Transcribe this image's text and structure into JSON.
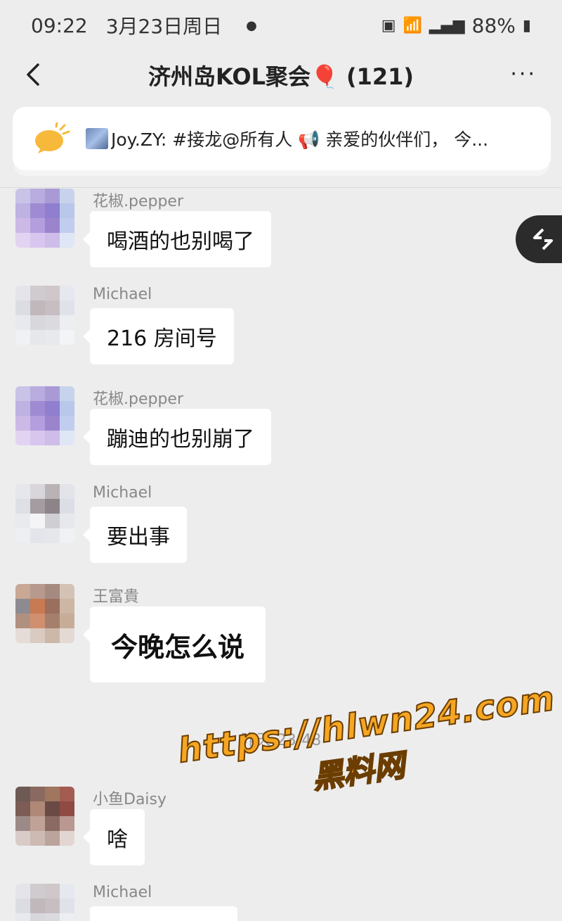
{
  "status_bar": {
    "time": "09:22",
    "date": "3月23日周日",
    "battery": "88%"
  },
  "nav": {
    "title": "济州岛KOL聚会🎈 (121)",
    "more": "···"
  },
  "announcement": {
    "text": "Joy.ZY: #接龙@所有人 📢 亲爱的伙伴们， 今..."
  },
  "messages": [
    {
      "sender": "花椒.pepper",
      "text": "喝酒的也别喝了"
    },
    {
      "sender": "Michael",
      "text": "216  房间号"
    },
    {
      "sender": "花椒.pepper",
      "text": "蹦迪的也别崩了"
    },
    {
      "sender": "Michael",
      "text": "要出事"
    },
    {
      "sender": "王富貴",
      "text": "今晚怎么说"
    },
    {
      "sender": "小鱼Daisy",
      "text": "啥"
    },
    {
      "sender": "Michael",
      "text": ""
    }
  ],
  "timestamp": "昨天 23:48",
  "watermark": {
    "url": "https://hlwn24.com",
    "name": "黑料网"
  },
  "colors": {
    "background": "#ededed",
    "bubble": "#ffffff",
    "watermark": "#f5a623"
  }
}
